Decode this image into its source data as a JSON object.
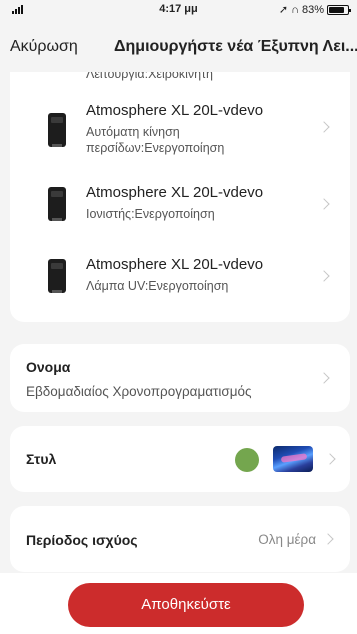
{
  "status_bar": {
    "time": "4:17 μμ",
    "battery_text": "83%",
    "battery_level": 0.83
  },
  "nav": {
    "cancel_label": "Ακύρωση",
    "title": "Δημιουργήστε νέα Έξυπνη Λει..."
  },
  "devices": [
    {
      "name": "",
      "detail": "Λειτουργία:Χειροκίνητη"
    },
    {
      "name": "Atmosphere XL 20L-vdevo",
      "detail": "Αυτόματη κίνηση περσίδων:Ενεργοποίηση"
    },
    {
      "name": "Atmosphere XL 20L-vdevo",
      "detail": "Ιονιστής:Ενεργοποίηση"
    },
    {
      "name": "Atmosphere XL 20L-vdevo",
      "detail": "Λάμπα UV:Ενεργοποίηση"
    }
  ],
  "name_section": {
    "label": "Ονομα",
    "value": "Εβδομαδιαίος Χρονοπρογραματισμός"
  },
  "style_section": {
    "label": "Στυλ",
    "color": "#74a64e"
  },
  "period_section": {
    "label": "Περίοδος ισχύος",
    "value": "Ολη μέρα"
  },
  "footer": {
    "save_label": "Αποθηκεύστε",
    "button_color": "#cc2c2c"
  }
}
